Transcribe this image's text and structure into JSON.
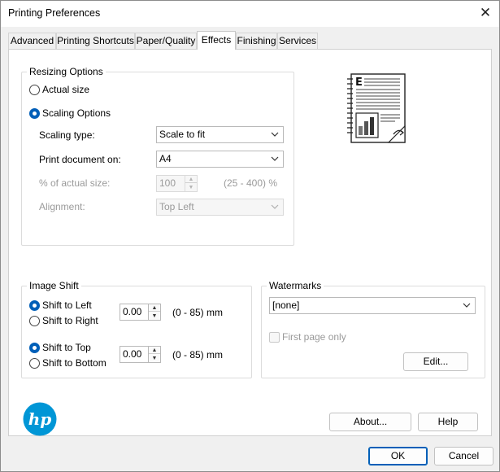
{
  "window": {
    "title": "Printing Preferences",
    "close_glyph": "✕"
  },
  "tabs": [
    {
      "label": "Advanced",
      "active": false
    },
    {
      "label": "Printing Shortcuts",
      "active": false
    },
    {
      "label": "Paper/Quality",
      "active": false
    },
    {
      "label": "Effects",
      "active": true
    },
    {
      "label": "Finishing",
      "active": false
    },
    {
      "label": "Services",
      "active": false
    }
  ],
  "resizing": {
    "group_label": "Resizing Options",
    "actual_size_label": "Actual size",
    "scaling_options_label": "Scaling Options",
    "selected": "Scaling Options",
    "scaling_type_label": "Scaling type:",
    "scaling_type_value": "Scale to fit",
    "print_on_label": "Print document on:",
    "print_on_value": "A4",
    "percent_label": "% of actual size:",
    "percent_value": "100",
    "percent_range": "(25 - 400) %",
    "alignment_label": "Alignment:",
    "alignment_value": "Top Left"
  },
  "image_shift": {
    "group_label": "Image Shift",
    "shift_left_label": "Shift to Left",
    "shift_right_label": "Shift to Right",
    "horizontal_selected": "Shift to Left",
    "horizontal_value": "0.00",
    "horizontal_range": "(0 - 85) mm",
    "shift_top_label": "Shift to Top",
    "shift_bottom_label": "Shift to Bottom",
    "vertical_selected": "Shift to Top",
    "vertical_value": "0.00",
    "vertical_range": "(0 - 85) mm"
  },
  "watermarks": {
    "group_label": "Watermarks",
    "selected_value": "[none]",
    "first_page_only_label": "First page only",
    "first_page_only_checked": false,
    "edit_button_label": "Edit..."
  },
  "preview": {
    "letter": "E",
    "icon": "document-preview-icon"
  },
  "brand": {
    "logo_text": "hp",
    "color": "#0096d6"
  },
  "footer": {
    "about_label": "About...",
    "help_label": "Help",
    "ok_label": "OK",
    "cancel_label": "Cancel"
  },
  "colors": {
    "accent": "#005fb8",
    "window_bg": "#f0f0f0",
    "panel_bg": "#ffffff"
  }
}
